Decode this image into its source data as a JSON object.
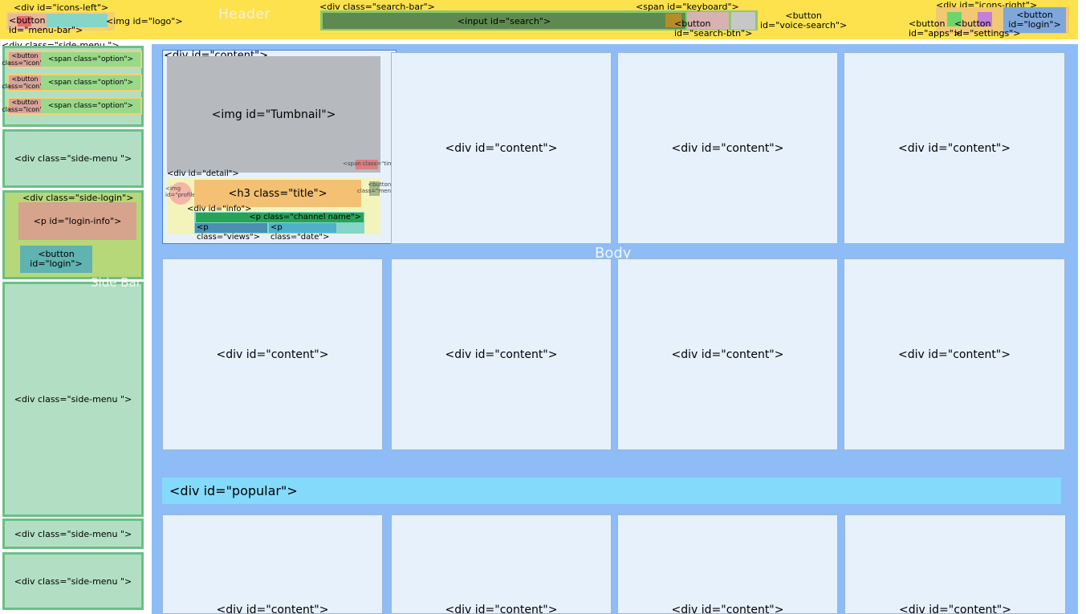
{
  "header": {
    "title": "Header",
    "icons_left_label": "<div id=\"icons-left\">",
    "menu_bar_label": "<button\nid=\"menu-bar\">",
    "logo_label": "<img id=\"logo\">",
    "search_bar_label": "<div class=\"search-bar\">",
    "search_input_label": "<input id=\"search\">",
    "keyboard_label": "<span id=\"keyboard\">",
    "search_btn_label": "<button\nid=\"search-btn\">",
    "voice_search_label": "<button\nid=\"voice-search\">",
    "icons_right_label": "<div id=\"icons-right\">",
    "apps_label": "<button\nid=\"apps\">",
    "settings_label": "<button\nid=\"settings\">",
    "login_label": "<button\nid=\"login\">"
  },
  "sidebar": {
    "title": "Side Bar",
    "side_menu_label": "<div class=\"side-menu \">",
    "icon_button_label": "<button\nclass=\"icon\">",
    "option_label": "<span class=\"option\">",
    "side_login_label": "<div class=\"side-login\">",
    "login_info_label": "<p id=\"login-info\">",
    "login_button_label": "<button\nid=\"login\">"
  },
  "main": {
    "title": "Body",
    "content_label": "<div id=\"content\">",
    "popular_label": "<div id=\"popular\">",
    "first_card": {
      "thumbnail_label": "<img id=\"Tumbnail\">",
      "time_label": "<span class=\"time\">",
      "detail_label": "<div id=\"detail\">",
      "profile_label": "<img\nid=\"profile\">",
      "title_label": "<h3 class=\"title\">",
      "menu_label": "<button\nclass=\"menu\">",
      "info_label": "<div id=\"info\">",
      "channel_label": "<p class=\"channel name\">",
      "views_label": "<p class=\"views\">",
      "date_label": "<p class=\"date\">"
    }
  },
  "colors": {
    "header": "#fde24d",
    "body": "#8ebcf7",
    "sidebar_menu": "#b2dfc3",
    "card": "#e6f1fc",
    "popular": "#84dafb"
  }
}
